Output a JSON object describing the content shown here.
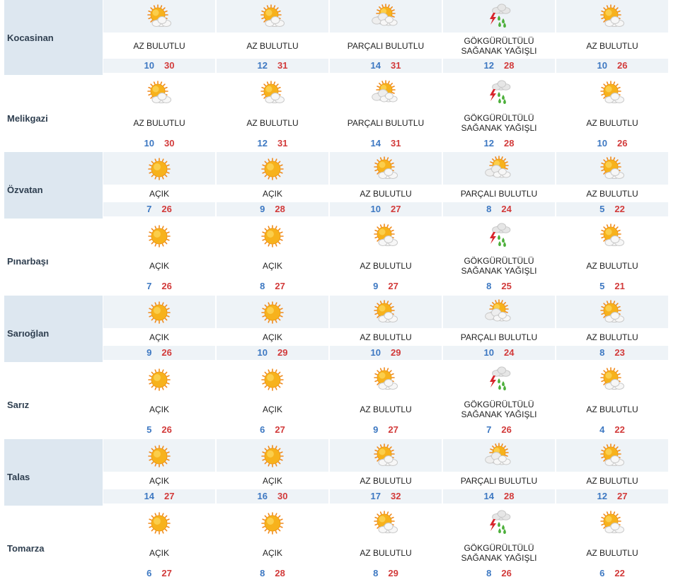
{
  "colors": {
    "min_temp": "#3d78c2",
    "max_temp": "#d23a3a",
    "name_panel": "#dde7f0",
    "band": "#eef3f7"
  },
  "districts": [
    {
      "name": "Kocasinan",
      "shaded": true,
      "days": [
        {
          "icon": "partly-sunny-icon",
          "desc": [
            "AZ BULUTLU"
          ],
          "min": "10",
          "max": "30"
        },
        {
          "icon": "partly-sunny-icon",
          "desc": [
            "AZ BULUTLU"
          ],
          "min": "12",
          "max": "31"
        },
        {
          "icon": "partly-cloudy-icon",
          "desc": [
            "PARÇALI BULUTLU"
          ],
          "min": "14",
          "max": "31"
        },
        {
          "icon": "thunderstorm-shower-icon",
          "desc": [
            "GÖKGÜRÜLTÜLÜ",
            "SAĞANAK YAĞIŞLI"
          ],
          "min": "12",
          "max": "28"
        },
        {
          "icon": "partly-sunny-icon",
          "desc": [
            "AZ BULUTLU"
          ],
          "min": "10",
          "max": "26"
        }
      ]
    },
    {
      "name": "Melikgazi",
      "shaded": false,
      "days": [
        {
          "icon": "partly-sunny-icon",
          "desc": [
            "AZ BULUTLU"
          ],
          "min": "10",
          "max": "30"
        },
        {
          "icon": "partly-sunny-icon",
          "desc": [
            "AZ BULUTLU"
          ],
          "min": "12",
          "max": "31"
        },
        {
          "icon": "partly-cloudy-icon",
          "desc": [
            "PARÇALI BULUTLU"
          ],
          "min": "14",
          "max": "31"
        },
        {
          "icon": "thunderstorm-shower-icon",
          "desc": [
            "GÖKGÜRÜLTÜLÜ",
            "SAĞANAK YAĞIŞLI"
          ],
          "min": "12",
          "max": "28"
        },
        {
          "icon": "partly-sunny-icon",
          "desc": [
            "AZ BULUTLU"
          ],
          "min": "10",
          "max": "26"
        }
      ]
    },
    {
      "name": "Özvatan",
      "shaded": true,
      "days": [
        {
          "icon": "sun-icon",
          "desc": [
            "AÇIK"
          ],
          "min": "7",
          "max": "26"
        },
        {
          "icon": "sun-icon",
          "desc": [
            "AÇIK"
          ],
          "min": "9",
          "max": "28"
        },
        {
          "icon": "partly-sunny-icon",
          "desc": [
            "AZ BULUTLU"
          ],
          "min": "10",
          "max": "27"
        },
        {
          "icon": "partly-cloudy-icon",
          "desc": [
            "PARÇALI BULUTLU"
          ],
          "min": "8",
          "max": "24"
        },
        {
          "icon": "partly-sunny-icon",
          "desc": [
            "AZ BULUTLU"
          ],
          "min": "5",
          "max": "22"
        }
      ]
    },
    {
      "name": "Pınarbaşı",
      "shaded": false,
      "days": [
        {
          "icon": "sun-icon",
          "desc": [
            "AÇIK"
          ],
          "min": "7",
          "max": "26"
        },
        {
          "icon": "sun-icon",
          "desc": [
            "AÇIK"
          ],
          "min": "8",
          "max": "27"
        },
        {
          "icon": "partly-sunny-icon",
          "desc": [
            "AZ BULUTLU"
          ],
          "min": "9",
          "max": "27"
        },
        {
          "icon": "thunderstorm-shower-icon",
          "desc": [
            "GÖKGÜRÜLTÜLÜ",
            "SAĞANAK YAĞIŞLI"
          ],
          "min": "8",
          "max": "25"
        },
        {
          "icon": "partly-sunny-icon",
          "desc": [
            "AZ BULUTLU"
          ],
          "min": "5",
          "max": "21"
        }
      ]
    },
    {
      "name": "Sarıoğlan",
      "shaded": true,
      "days": [
        {
          "icon": "sun-icon",
          "desc": [
            "AÇIK"
          ],
          "min": "9",
          "max": "26"
        },
        {
          "icon": "sun-icon",
          "desc": [
            "AÇIK"
          ],
          "min": "10",
          "max": "29"
        },
        {
          "icon": "partly-sunny-icon",
          "desc": [
            "AZ BULUTLU"
          ],
          "min": "10",
          "max": "29"
        },
        {
          "icon": "partly-cloudy-icon",
          "desc": [
            "PARÇALI BULUTLU"
          ],
          "min": "10",
          "max": "24"
        },
        {
          "icon": "partly-sunny-icon",
          "desc": [
            "AZ BULUTLU"
          ],
          "min": "8",
          "max": "23"
        }
      ]
    },
    {
      "name": "Sarız",
      "shaded": false,
      "days": [
        {
          "icon": "sun-icon",
          "desc": [
            "AÇIK"
          ],
          "min": "5",
          "max": "26"
        },
        {
          "icon": "sun-icon",
          "desc": [
            "AÇIK"
          ],
          "min": "6",
          "max": "27"
        },
        {
          "icon": "partly-sunny-icon",
          "desc": [
            "AZ BULUTLU"
          ],
          "min": "9",
          "max": "27"
        },
        {
          "icon": "thunderstorm-shower-icon",
          "desc": [
            "GÖKGÜRÜLTÜLÜ",
            "SAĞANAK YAĞIŞLI"
          ],
          "min": "7",
          "max": "26"
        },
        {
          "icon": "partly-sunny-icon",
          "desc": [
            "AZ BULUTLU"
          ],
          "min": "4",
          "max": "22"
        }
      ]
    },
    {
      "name": "Talas",
      "shaded": true,
      "days": [
        {
          "icon": "sun-icon",
          "desc": [
            "AÇIK"
          ],
          "min": "14",
          "max": "27"
        },
        {
          "icon": "sun-icon",
          "desc": [
            "AÇIK"
          ],
          "min": "16",
          "max": "30"
        },
        {
          "icon": "partly-sunny-icon",
          "desc": [
            "AZ BULUTLU"
          ],
          "min": "17",
          "max": "32"
        },
        {
          "icon": "partly-cloudy-icon",
          "desc": [
            "PARÇALI BULUTLU"
          ],
          "min": "14",
          "max": "28"
        },
        {
          "icon": "partly-sunny-icon",
          "desc": [
            "AZ BULUTLU"
          ],
          "min": "12",
          "max": "27"
        }
      ]
    },
    {
      "name": "Tomarza",
      "shaded": false,
      "days": [
        {
          "icon": "sun-icon",
          "desc": [
            "AÇIK"
          ],
          "min": "6",
          "max": "27"
        },
        {
          "icon": "sun-icon",
          "desc": [
            "AÇIK"
          ],
          "min": "8",
          "max": "28"
        },
        {
          "icon": "partly-sunny-icon",
          "desc": [
            "AZ BULUTLU"
          ],
          "min": "8",
          "max": "29"
        },
        {
          "icon": "thunderstorm-shower-icon",
          "desc": [
            "GÖKGÜRÜLTÜLÜ",
            "SAĞANAK YAĞIŞLI"
          ],
          "min": "8",
          "max": "26"
        },
        {
          "icon": "partly-sunny-icon",
          "desc": [
            "AZ BULUTLU"
          ],
          "min": "6",
          "max": "22"
        }
      ]
    }
  ]
}
